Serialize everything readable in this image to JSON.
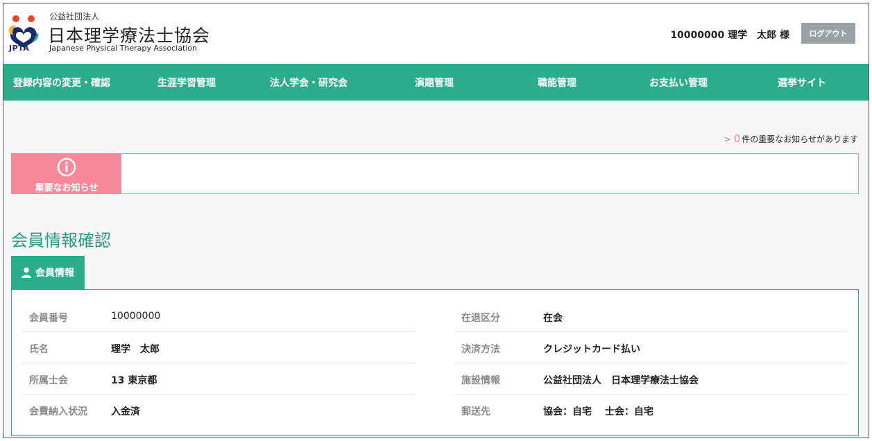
{
  "header": {
    "org_small": "公益社団法人",
    "org_name": "日本理学療法士協会",
    "org_en": "Japanese Physical Therapy Association",
    "logo_abbr": "JPTA",
    "user_display": "10000000  理学　太郎 様",
    "logout_label": "ログアウト"
  },
  "nav": {
    "items": [
      "登録内容の変更・確認",
      "生涯学習管理",
      "法人学会・研究会",
      "演題管理",
      "職能管理",
      "お支払い管理",
      "選挙サイト"
    ]
  },
  "notice": {
    "count": "0",
    "count_suffix": "件の重要なお知らせがあります",
    "label": "重要なお知らせ"
  },
  "page": {
    "title": "会員情報確認",
    "tab_label": "会員情報"
  },
  "member": {
    "left": [
      {
        "label": "会員番号",
        "value": "10000000"
      },
      {
        "label": "氏名",
        "value": "理学　太郎"
      },
      {
        "label": "所属士会",
        "value": "13 東京都"
      },
      {
        "label": "会費納入状況",
        "value": "入金済"
      }
    ],
    "right": [
      {
        "label": "在退区分",
        "value": "在会"
      },
      {
        "label": "決済方法",
        "value": "クレジットカード払い"
      },
      {
        "label": "施設情報",
        "value": "公益社団法人　日本理学療法士協会"
      },
      {
        "label": "郵送先",
        "value": "協会：自宅　 士会：自宅"
      }
    ]
  },
  "colors": {
    "brand_green": "#2cad8a",
    "notice_pink": "#f8899a"
  }
}
